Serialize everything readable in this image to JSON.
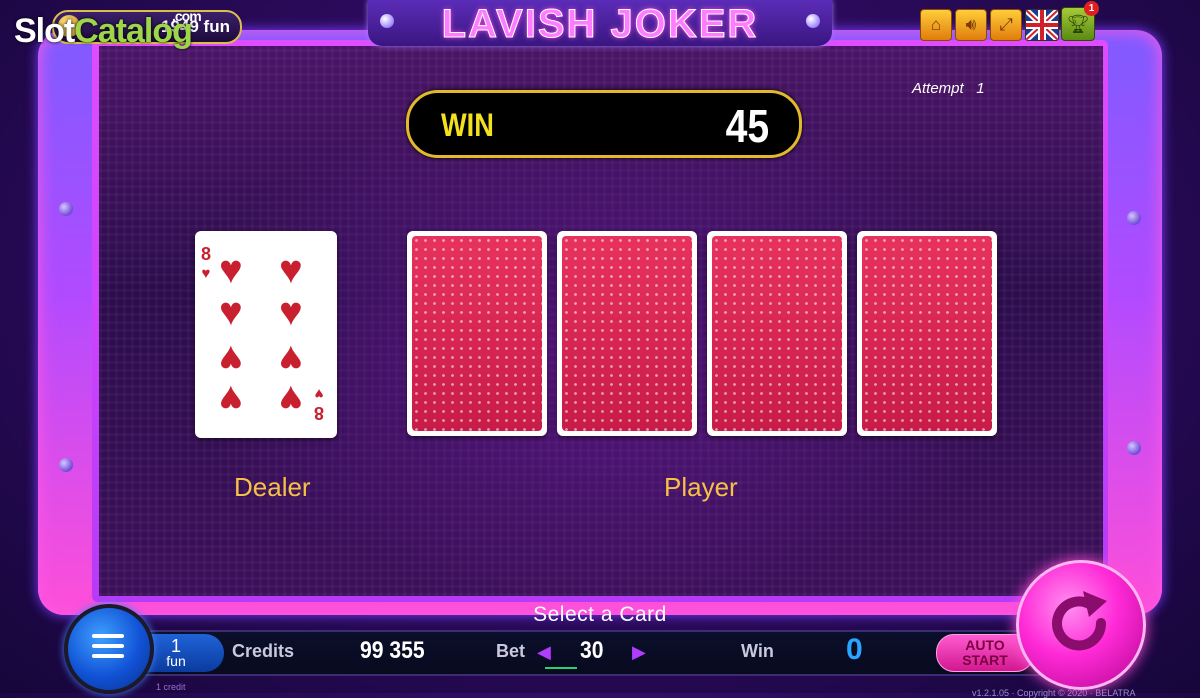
{
  "header": {
    "game_title": "LAVISH JOKER",
    "balance_display": "1949 fun",
    "watermark": {
      "part1": "Slot",
      "part2": "Catalog",
      "suffix": ".com"
    },
    "buttons": [
      {
        "name": "home",
        "icon": "home-icon"
      },
      {
        "name": "sound",
        "icon": "speaker-icon"
      },
      {
        "name": "fullscreen",
        "icon": "expand-icon"
      },
      {
        "name": "language",
        "icon": "uk-flag-icon"
      },
      {
        "name": "trophy",
        "icon": "trophy-icon",
        "badge": "1"
      }
    ]
  },
  "gamble": {
    "win_label": "WIN",
    "win_value": "45",
    "attempt_label": "Attempt",
    "attempt_value": "1",
    "dealer_label": "Dealer",
    "player_label": "Player",
    "dealer_card": {
      "rank": "8",
      "suit": "♥",
      "suit_name": "hearts"
    },
    "player_cards": [
      "face-down",
      "face-down",
      "face-down",
      "face-down"
    ],
    "status_message": "Select a Card"
  },
  "bottom_bar": {
    "fun_value": "1",
    "fun_unit": "fun",
    "credit_note": "1 credit",
    "credits_label": "Credits",
    "credits_value": "99 355",
    "bet_label": "Bet",
    "bet_value": "30",
    "win_label": "Win",
    "win_value": "0",
    "auto_start_line1": "AUTO",
    "auto_start_line2": "START",
    "copyright": "v1.2.1.05 · Copyright © 2020 · BELATRA"
  },
  "colors": {
    "accent_pink": "#ff2ad7",
    "frame_purple": "#7f5bff",
    "win_gold": "#f3e120",
    "label_gold": "#f7c046",
    "card_red": "#c8202e"
  }
}
